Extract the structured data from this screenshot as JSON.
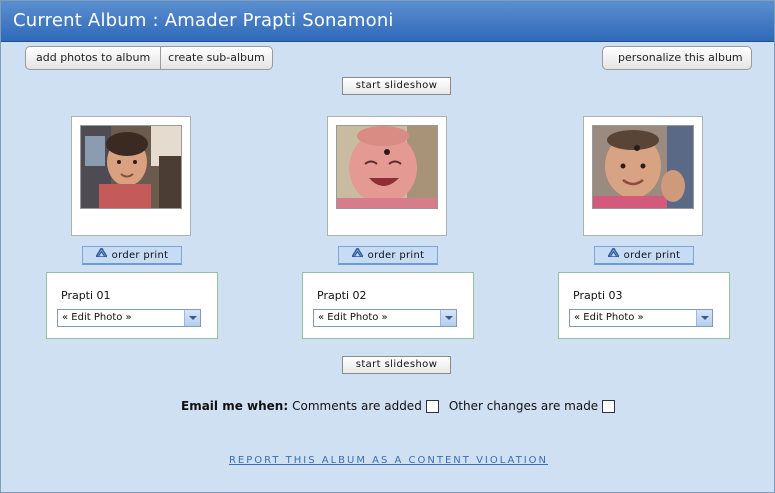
{
  "header": {
    "title": "Current Album : Amader Prapti Sonamoni"
  },
  "toolbar": {
    "add_photos_label": "add photos to album",
    "create_subalbum_label": "create sub-album",
    "personalize_label": "personalize this album"
  },
  "slideshow": {
    "label": "start slideshow"
  },
  "photos": [
    {
      "name": "Prapti 01",
      "order_label": "order print",
      "edit_select": "« Edit Photo »"
    },
    {
      "name": "Prapti 02",
      "order_label": "order print",
      "edit_select": "« Edit Photo »"
    },
    {
      "name": "Prapti 03",
      "order_label": "order print",
      "edit_select": "« Edit Photo »"
    }
  ],
  "email": {
    "label": "Email me when:",
    "option1": "Comments are added",
    "option2": "Other changes are made",
    "option1_checked": false,
    "option2_checked": false
  },
  "report": {
    "label": "REPORT THIS ALBUM AS A CONTENT VIOLATION"
  },
  "icons": {
    "order": "order-print-icon",
    "dropdown": "chevron-down-icon"
  },
  "colors": {
    "header_top": "#5b8fd0",
    "header_bottom": "#2f69b8",
    "background": "#cfe0f2",
    "link": "#3a6fb0"
  }
}
